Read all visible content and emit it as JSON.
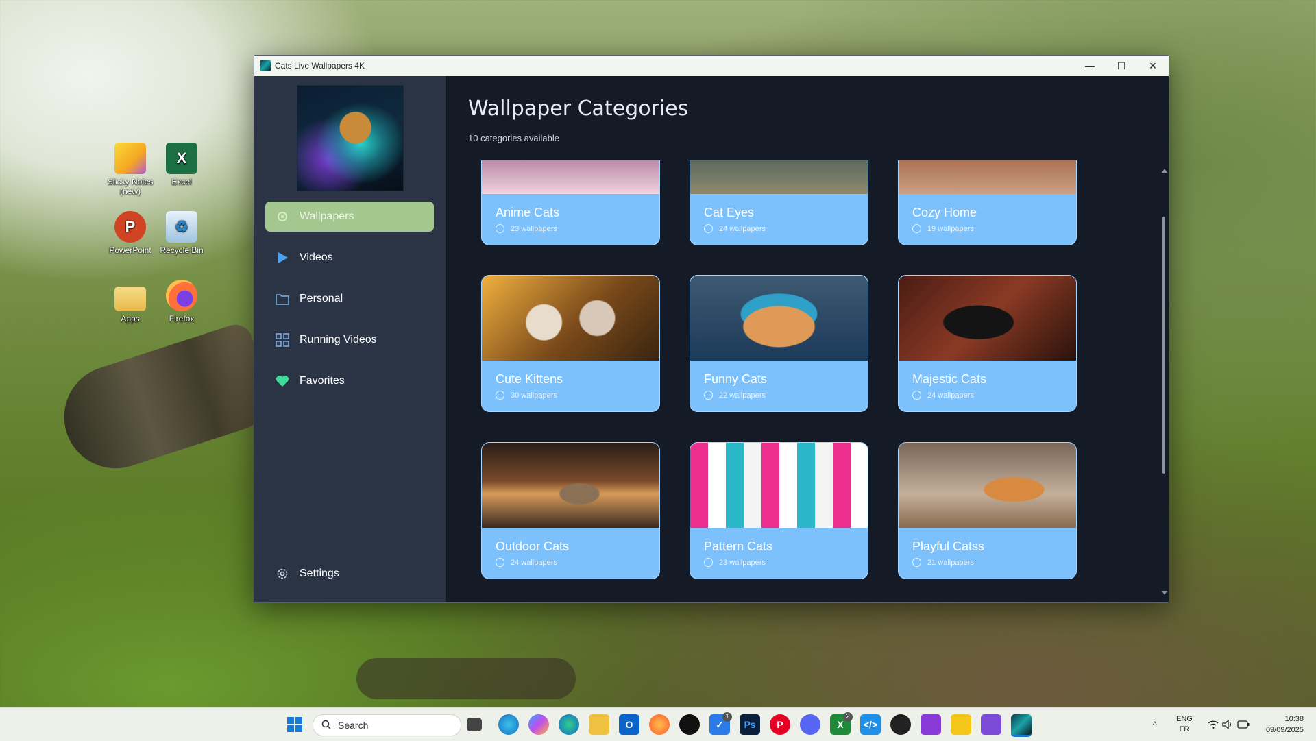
{
  "desktop": {
    "icons": [
      {
        "label": "Sticky Notes (new)",
        "glyph": "",
        "color": "#f5c518"
      },
      {
        "label": "Excel",
        "glyph": "X",
        "color": "#1d7044"
      },
      {
        "label": "PowerPoint",
        "glyph": "P",
        "color": "#d04423"
      },
      {
        "label": "Recycle Bin",
        "glyph": "♻",
        "color": "#9fc4e0"
      },
      {
        "label": "Apps",
        "glyph": "",
        "color": "#f2cf6a"
      },
      {
        "label": "Firefox",
        "glyph": "",
        "color": "#ff7139"
      }
    ]
  },
  "window": {
    "title": "Cats Live Wallpapers 4K",
    "minimize": "—",
    "maximize": "☐",
    "close": "✕"
  },
  "sidebar": {
    "items": [
      {
        "label": "Wallpapers",
        "icon": "gear-icon",
        "active": true
      },
      {
        "label": "Videos",
        "icon": "play-icon"
      },
      {
        "label": "Personal",
        "icon": "folder-icon"
      },
      {
        "label": "Running Videos",
        "icon": "grid-icon"
      },
      {
        "label": "Favorites",
        "icon": "heart-icon"
      }
    ],
    "settings_label": "Settings"
  },
  "main": {
    "title": "Wallpaper Categories",
    "subtitle": "10 categories available",
    "categories": [
      {
        "title": "Anime Cats",
        "count": "23 wallpapers"
      },
      {
        "title": "Cat Eyes",
        "count": "24 wallpapers"
      },
      {
        "title": "Cozy Home",
        "count": "19 wallpapers"
      },
      {
        "title": "Cute Kittens",
        "count": "30 wallpapers"
      },
      {
        "title": "Funny Cats",
        "count": "22 wallpapers"
      },
      {
        "title": "Majestic Cats",
        "count": "24 wallpapers"
      },
      {
        "title": "Outdoor Cats",
        "count": "24 wallpapers"
      },
      {
        "title": "Pattern Cats",
        "count": "23 wallpapers"
      },
      {
        "title": "Playful Catss",
        "count": "21 wallpapers"
      }
    ]
  },
  "taskbar": {
    "search_placeholder": "Search",
    "badges": {
      "todo": "1",
      "xbox": "2"
    },
    "lang_top": "ENG",
    "lang_bottom": "FR",
    "time": "10:38",
    "date": "09/09/2025"
  },
  "colors": {
    "card_bg": "#7cc1fb",
    "active_nav": "#a4c790",
    "sidebar_bg": "#2a3444",
    "main_bg": "#141a26"
  }
}
